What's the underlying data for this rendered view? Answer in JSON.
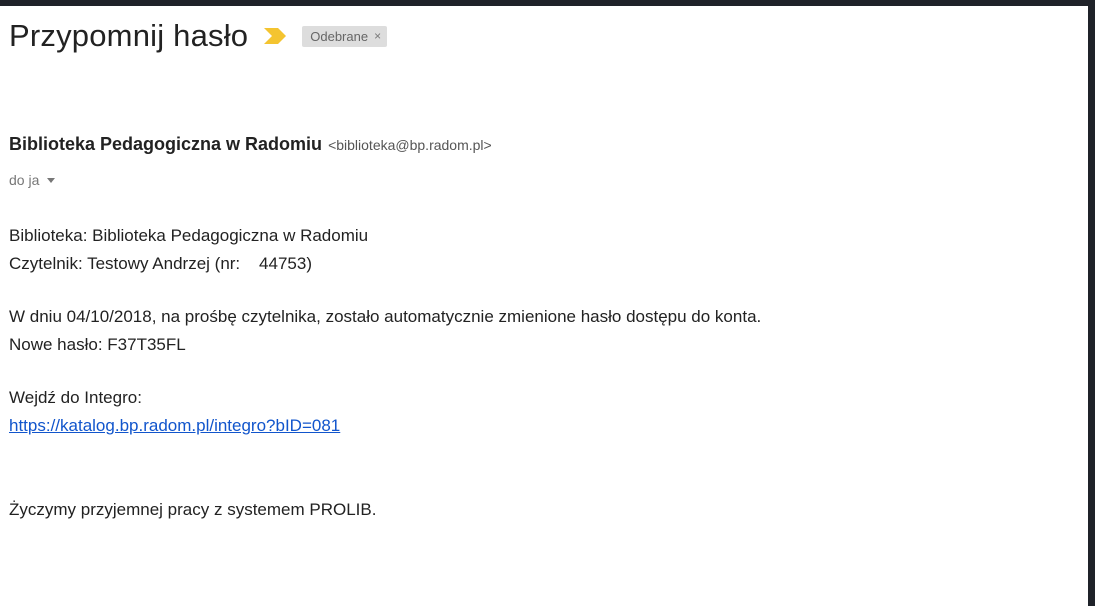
{
  "email": {
    "subject": "Przypomnij hasło",
    "label": "Odebrane",
    "label_remove": "×",
    "sender_name": "Biblioteka Pedagogiczna w Radomiu",
    "sender_email": "<biblioteka@bp.radom.pl>",
    "recipient": "do ja",
    "body": {
      "library_line": "Biblioteka: Biblioteka Pedagogiczna w Radomiu",
      "reader_line": "Czytelnik: Testowy Andrzej (nr:    44753)",
      "date_line": "W dniu 04/10/2018, na prośbę czytelnika, zostało automatycznie zmienione hasło dostępu do konta.",
      "password_line": "Nowe hasło: F37T35FL",
      "enter_line": "Wejdź do Integro:",
      "link": "https://katalog.bp.radom.pl/integro?bID=081",
      "closing_line": "Życzymy przyjemnej pracy z systemem PROLIB."
    }
  },
  "colors": {
    "importance": "#f4c430",
    "link": "#1155cc",
    "label_bg": "#dddddd"
  },
  "icons": {
    "importance": "importance-marker-icon",
    "details": "chevron-down-icon"
  }
}
